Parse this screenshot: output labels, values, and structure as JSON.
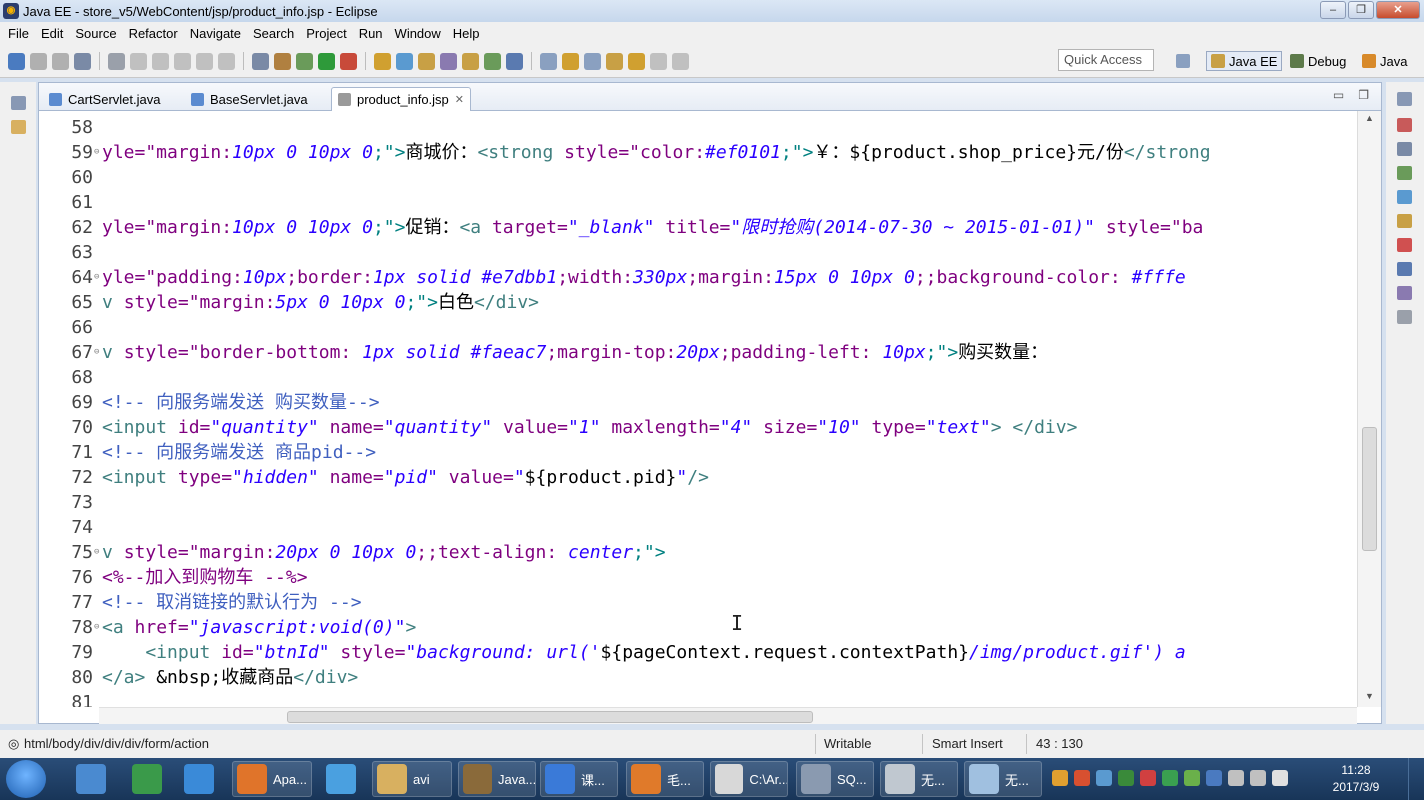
{
  "window": {
    "title": "Java EE - store_v5/WebContent/jsp/product_info.jsp - Eclipse"
  },
  "menus": [
    "File",
    "Edit",
    "Source",
    "Refactor",
    "Navigate",
    "Search",
    "Project",
    "Run",
    "Window",
    "Help"
  ],
  "toolbar": {
    "quick_access": "Quick Access",
    "perspectives": [
      "Java EE",
      "Debug",
      "Java"
    ]
  },
  "tabs": [
    {
      "label": "CartServlet.java",
      "active": false
    },
    {
      "label": "BaseServlet.java",
      "active": false
    },
    {
      "label": "product_info.jsp",
      "active": true
    }
  ],
  "code_lines": [
    {
      "n": "58",
      "fold": "",
      "segs": []
    },
    {
      "n": "59",
      "fold": "⊖",
      "segs": [
        [
          "yle=\"margin:",
          "#7f007f"
        ],
        [
          "10px 0 10px 0",
          "#2a00ff",
          1
        ],
        [
          ";\">",
          "#008080"
        ],
        [
          "商城价：",
          "#000"
        ],
        [
          "<strong ",
          "#3f7f7f"
        ],
        [
          "style=\"color:",
          "#7f007f"
        ],
        [
          "#ef0101",
          "#2a00ff",
          1
        ],
        [
          ";\">",
          "#008080"
        ],
        [
          "￥：${product.shop_price}元/份",
          "#000"
        ],
        [
          "</strong",
          "#3f7f7f"
        ]
      ]
    },
    {
      "n": "60",
      "fold": "",
      "segs": []
    },
    {
      "n": "61",
      "fold": "",
      "segs": []
    },
    {
      "n": "62",
      "fold": "",
      "segs": [
        [
          "yle=\"margin:",
          "#7f007f"
        ],
        [
          "10px 0 10px 0",
          "#2a00ff",
          1
        ],
        [
          ";\">",
          "#008080"
        ],
        [
          "促销：",
          "#000"
        ],
        [
          "<a ",
          "#3f7f7f"
        ],
        [
          "target=",
          "#7f007f"
        ],
        [
          "\"_blank\"",
          "#2a00ff",
          1
        ],
        [
          " title=",
          "#7f007f"
        ],
        [
          "\"限时抢购(2014-07-30 ~ 2015-01-01)\"",
          "#2a00ff",
          1
        ],
        [
          " style=\"ba",
          "#7f007f"
        ]
      ]
    },
    {
      "n": "63",
      "fold": "",
      "segs": []
    },
    {
      "n": "64",
      "fold": "⊖",
      "segs": [
        [
          "yle=\"padding:",
          "#7f007f"
        ],
        [
          "10px",
          "#2a00ff",
          1
        ],
        [
          ";border:",
          "#7f007f"
        ],
        [
          "1px solid #e7dbb1",
          "#2a00ff",
          1
        ],
        [
          ";width:",
          "#7f007f"
        ],
        [
          "330px",
          "#2a00ff",
          1
        ],
        [
          ";margin:",
          "#7f007f"
        ],
        [
          "15px 0 10px 0",
          "#2a00ff",
          1
        ],
        [
          ";;background-color: ",
          "#7f007f"
        ],
        [
          "#fffe",
          "#2a00ff",
          1
        ]
      ]
    },
    {
      "n": "65",
      "fold": "",
      "segs": [
        [
          "v ",
          "#3f7f7f"
        ],
        [
          "style=\"margin:",
          "#7f007f"
        ],
        [
          "5px 0 10px 0",
          "#2a00ff",
          1
        ],
        [
          ";\">",
          "#008080"
        ],
        [
          "白色",
          "#000"
        ],
        [
          "</div>",
          "#3f7f7f"
        ]
      ]
    },
    {
      "n": "66",
      "fold": "",
      "segs": []
    },
    {
      "n": "67",
      "fold": "⊖",
      "segs": [
        [
          "v ",
          "#3f7f7f"
        ],
        [
          "style=\"border-bottom: ",
          "#7f007f"
        ],
        [
          "1px solid #faeac7",
          "#2a00ff",
          1
        ],
        [
          ";margin-top:",
          "#7f007f"
        ],
        [
          "20px",
          "#2a00ff",
          1
        ],
        [
          ";padding-left: ",
          "#7f007f"
        ],
        [
          "10px",
          "#2a00ff",
          1
        ],
        [
          ";\">",
          "#008080"
        ],
        [
          "购买数量：",
          "#000"
        ]
      ]
    },
    {
      "n": "68",
      "fold": "",
      "segs": []
    },
    {
      "n": "69",
      "fold": "",
      "segs": [
        [
          "<!-- 向服务端发送 购买数量-->",
          "#3f5fbf"
        ]
      ]
    },
    {
      "n": "70",
      "fold": "",
      "segs": [
        [
          "<input ",
          "#3f7f7f"
        ],
        [
          "id=",
          "#7f007f"
        ],
        [
          "\"quantity\"",
          "#2a00ff",
          1
        ],
        [
          " name=",
          "#7f007f"
        ],
        [
          "\"quantity\"",
          "#2a00ff",
          1
        ],
        [
          " value=",
          "#7f007f"
        ],
        [
          "\"1\"",
          "#2a00ff",
          1
        ],
        [
          " maxlength=",
          "#7f007f"
        ],
        [
          "\"4\"",
          "#2a00ff",
          1
        ],
        [
          " size=",
          "#7f007f"
        ],
        [
          "\"10\"",
          "#2a00ff",
          1
        ],
        [
          " type=",
          "#7f007f"
        ],
        [
          "\"text\"",
          "#2a00ff",
          1
        ],
        [
          "> </div>",
          "#3f7f7f"
        ]
      ]
    },
    {
      "n": "71",
      "fold": "",
      "segs": [
        [
          "<!-- 向服务端发送 商品pid-->",
          "#3f5fbf"
        ]
      ]
    },
    {
      "n": "72",
      "fold": "",
      "segs": [
        [
          "<input ",
          "#3f7f7f"
        ],
        [
          "type=",
          "#7f007f"
        ],
        [
          "\"hidden\"",
          "#2a00ff",
          1
        ],
        [
          " name=",
          "#7f007f"
        ],
        [
          "\"pid\"",
          "#2a00ff",
          1
        ],
        [
          " value=",
          "#7f007f"
        ],
        [
          "\"",
          "#2a00ff",
          1
        ],
        [
          "${product.pid}",
          "#000"
        ],
        [
          "\"",
          "#2a00ff",
          1
        ],
        [
          "/>",
          "#3f7f7f"
        ]
      ]
    },
    {
      "n": "73",
      "fold": "",
      "segs": []
    },
    {
      "n": "74",
      "fold": "",
      "segs": []
    },
    {
      "n": "75",
      "fold": "⊖",
      "segs": [
        [
          "v ",
          "#3f7f7f"
        ],
        [
          "style=\"margin:",
          "#7f007f"
        ],
        [
          "20px 0 10px 0",
          "#2a00ff",
          1
        ],
        [
          ";;text-align: ",
          "#7f007f"
        ],
        [
          "center",
          "#2a00ff",
          1
        ],
        [
          ";\">",
          "#008080"
        ]
      ]
    },
    {
      "n": "76",
      "fold": "",
      "segs": [
        [
          "<%--加入到购物车 --%>",
          "#7f007f"
        ]
      ]
    },
    {
      "n": "77",
      "fold": "",
      "segs": [
        [
          "<!-- 取消链接的默认行为 -->",
          "#3f5fbf"
        ]
      ]
    },
    {
      "n": "78",
      "fold": "⊖",
      "segs": [
        [
          "<a ",
          "#3f7f7f"
        ],
        [
          "href=",
          "#7f007f"
        ],
        [
          "\"javascript:void(0)\"",
          "#2a00ff",
          1
        ],
        [
          ">",
          "#3f7f7f"
        ]
      ]
    },
    {
      "n": "79",
      "fold": "",
      "segs": [
        [
          "    <input ",
          "#3f7f7f"
        ],
        [
          "id=",
          "#7f007f"
        ],
        [
          "\"btnId\"",
          "#2a00ff",
          1
        ],
        [
          " style=",
          "#7f007f"
        ],
        [
          "\"background: url('",
          "#2a00ff",
          1
        ],
        [
          "${pageContext.request.contextPath}",
          "#000"
        ],
        [
          "/img/product.gif') a",
          "#2a00ff",
          1
        ]
      ]
    },
    {
      "n": "80",
      "fold": "",
      "segs": [
        [
          "</a> ",
          "#3f7f7f"
        ],
        [
          "&nbsp;",
          "#000"
        ],
        [
          "收藏商品",
          "#000"
        ],
        [
          "</div>",
          "#3f7f7f"
        ]
      ]
    },
    {
      "n": "81",
      "fold": "",
      "segs": []
    }
  ],
  "status": {
    "path": "html/body/div/div/div/form/action",
    "mode": "Writable",
    "insert": "Smart Insert",
    "position": "43 : 130"
  },
  "taskbar": {
    "items": [
      "",
      "",
      "",
      "Apa...",
      "",
      "avi",
      "Java...",
      "课...",
      "毛...",
      "C:\\Ar...",
      "SQ...",
      "无...",
      "无..."
    ],
    "time": "11:28",
    "date": "2017/3/9"
  }
}
